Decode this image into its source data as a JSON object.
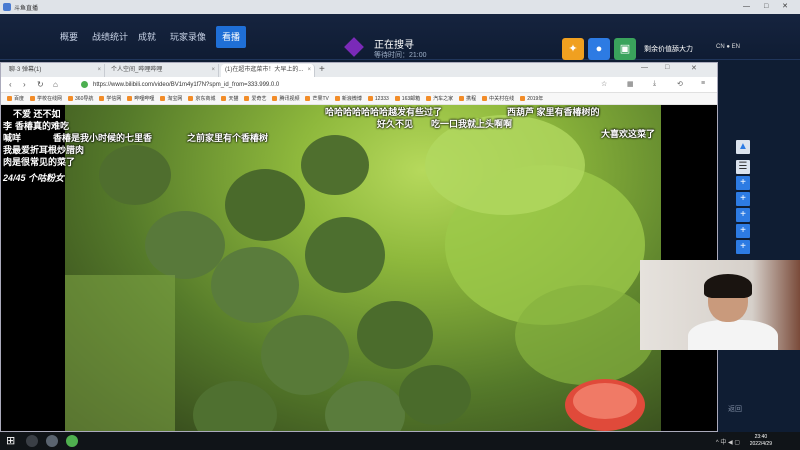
{
  "client": {
    "title": "斗鱼直播",
    "window_controls": "— □ ✕",
    "nav": [
      "概要",
      "战绩统计",
      "成就",
      "玩家录像",
      "看播"
    ],
    "active_nav": "看播",
    "search_status": "正在搜寻",
    "search_sub": "等待时间：21:00",
    "right_text": "剩余价值舔大力",
    "flags": "CN ● EN"
  },
  "browser": {
    "tabs": [
      {
        "label": "聊·3 弹幕(1)",
        "active": false
      },
      {
        "label": "个人空间_哔哩哔哩",
        "active": false
      },
      {
        "label": "(1)在超市逛菜市！大早上的...",
        "active": true
      }
    ],
    "new_tab": "+",
    "url": "https://www.bilibili.com/video/BV1m4y1f7N?spm_id_from=333.999.0.0",
    "bookmarks": [
      "百度",
      "学校在线网",
      "360导航",
      "学信网",
      "哔哩哔哩",
      "淘宝网",
      "京东商城",
      "天猫",
      "爱奇艺",
      "腾讯视频",
      "芒果TV",
      "新浪微博",
      "12333",
      "163邮箱",
      "汽车之家",
      "携程",
      "中关村在线",
      "2019年"
    ]
  },
  "danmaku": [
    "不爱  还不如",
    "香椿真的难吃",
    "李",
    "喊咩",
    "香椿是我小时候的七里香",
    "之前家里有个香椿树",
    "我最爱折耳根炒腊肉",
    "肉是很常见的菜了",
    "24/45 个咕粉女",
    "哈哈哈哈哈哈哈越发有些过了",
    "西葫芦  家里有香椿树的",
    "吃一口我就上头啊啊",
    "好久不见",
    "大喜欢这菜了"
  ],
  "side": {
    "bottom_text": "返回"
  },
  "taskbar": {
    "time": "23:40",
    "date": "2022/4/29",
    "tray": "^ 中 ◀ ▢"
  }
}
